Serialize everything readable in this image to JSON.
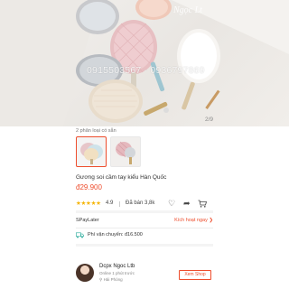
{
  "hero": {
    "watermark_phone": "0915503567 - 0936797869",
    "image_counter": "2/9"
  },
  "variants": {
    "count_label": "2 phân loại có sẵn"
  },
  "product": {
    "title": "Gương soi cầm tay kiểu Hàn Quốc",
    "price": "đ29.900",
    "rating_stars": "★★★★★",
    "rating": "4.9",
    "sold": "Đã bán 3,8k"
  },
  "spaylater": {
    "label": "SPayLater",
    "link": "Kích hoạt ngay ❯"
  },
  "shipping": {
    "label": "Phí vận chuyển: đ16.500"
  },
  "shop": {
    "name": "Dcpx Ngoc Ltb",
    "status": "Online 1 phút trước",
    "location": "Hải Phòng",
    "view_button": "Xem Shop"
  },
  "icons": {
    "favorite": "heart-icon",
    "share": "share-icon",
    "cart": "cart-icon",
    "shipping": "truck-icon",
    "location": "pin-icon"
  },
  "colors": {
    "accent": "#ee4d2d",
    "star": "#f5b400"
  }
}
